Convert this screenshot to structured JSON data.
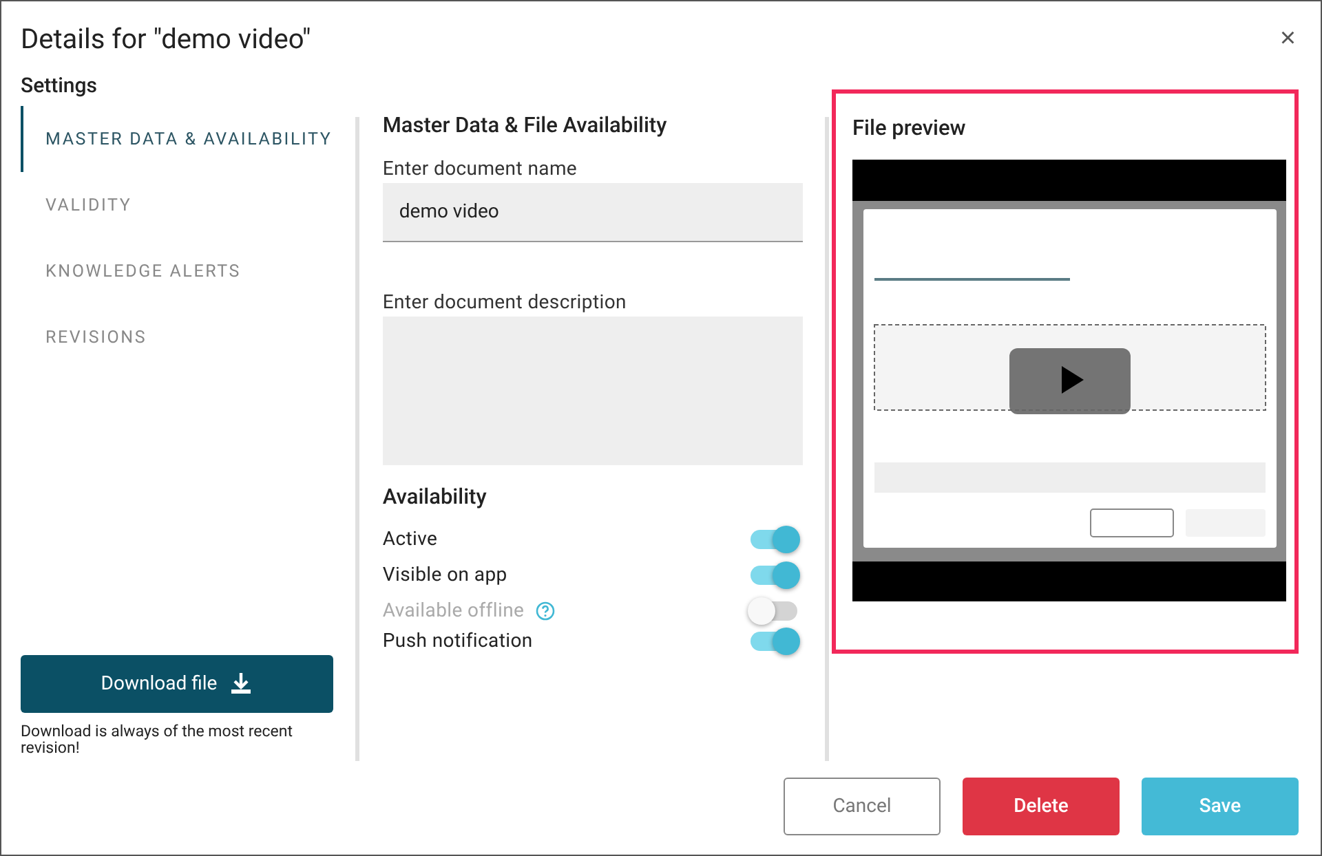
{
  "dialog": {
    "title": "Details for \"demo video\"",
    "close": "×"
  },
  "settings": {
    "heading": "Settings",
    "tabs": [
      {
        "label": "MASTER DATA & AVAILABILITY",
        "selected": true
      },
      {
        "label": "VALIDITY",
        "selected": false
      },
      {
        "label": "KNOWLEDGE ALERTS",
        "selected": false
      },
      {
        "label": "REVISIONS",
        "selected": false
      }
    ],
    "download_button": "Download file",
    "download_note": "Download is always of the most recent revision!"
  },
  "master_data": {
    "heading": "Master Data & File Availability",
    "name_label": "Enter document name",
    "name_value": "demo video",
    "description_label": "Enter document description"
  },
  "availability": {
    "heading": "Availability",
    "toggles": [
      {
        "label": "Active",
        "on": true,
        "disabled": false,
        "help": false
      },
      {
        "label": "Visible on app",
        "on": true,
        "disabled": false,
        "help": false
      },
      {
        "label": "Available offline",
        "on": false,
        "disabled": true,
        "help": true
      },
      {
        "label": "Push notification",
        "on": true,
        "disabled": false,
        "help": false
      }
    ]
  },
  "preview": {
    "heading": "File preview"
  },
  "buttons": [
    {
      "label": "Cancel",
      "kind": "outline"
    },
    {
      "label": "Delete",
      "kind": "danger"
    },
    {
      "label": "Save",
      "kind": "primary"
    }
  ]
}
